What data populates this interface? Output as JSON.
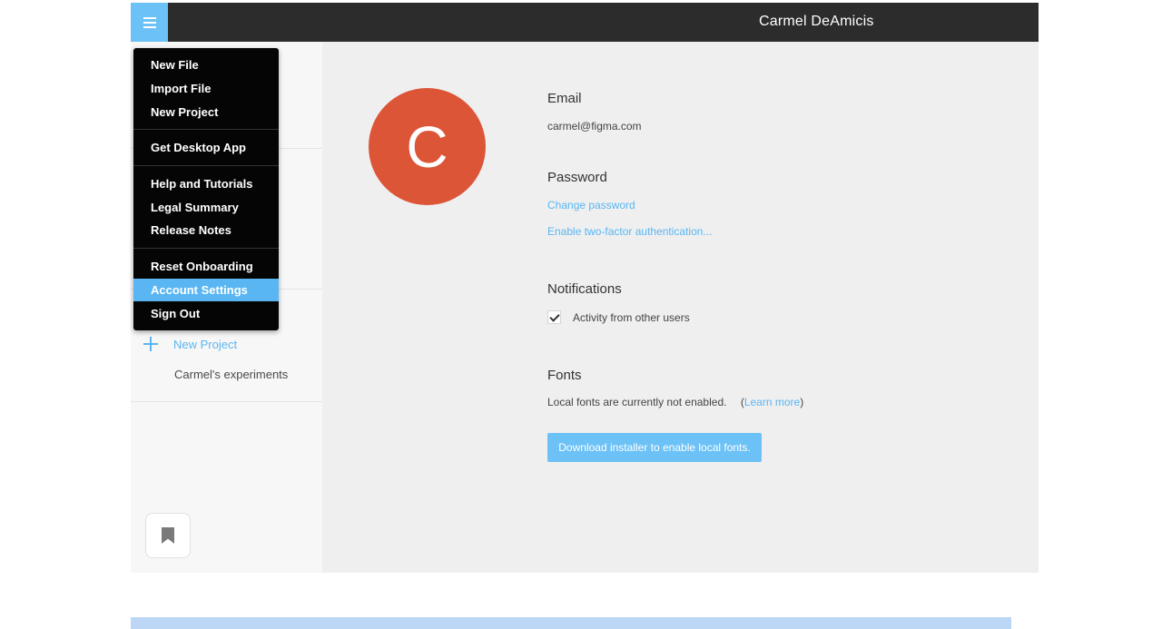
{
  "header": {
    "user_name": "Carmel DeAmicis"
  },
  "menu": {
    "groups": [
      [
        "New File",
        "Import File",
        "New Project"
      ],
      [
        "Get Desktop App"
      ],
      [
        "Help and Tutorials",
        "Legal Summary",
        "Release Notes"
      ],
      [
        "Reset Onboarding",
        "Account Settings",
        "Sign Out"
      ]
    ],
    "active_item": "Account Settings"
  },
  "sidebar": {
    "new_project_label": "New Project",
    "project_item": "Carmel's experiments"
  },
  "profile": {
    "avatar_initial": "C",
    "avatar_color": "#dd5537"
  },
  "settings": {
    "email": {
      "title": "Email",
      "value": "carmel@figma.com"
    },
    "password": {
      "title": "Password",
      "change_link": "Change password",
      "two_factor_link": "Enable two-factor authentication..."
    },
    "notifications": {
      "title": "Notifications",
      "activity_label": "Activity from other users",
      "activity_checked": true
    },
    "fonts": {
      "title": "Fonts",
      "status_text": "Local fonts are currently not enabled.",
      "learn_more": "Learn more",
      "download_button": "Download installer to enable local fonts."
    }
  },
  "colors": {
    "accent": "#6cc1f6",
    "link": "#5ab6f2",
    "topbar": "#2c2c2c"
  }
}
